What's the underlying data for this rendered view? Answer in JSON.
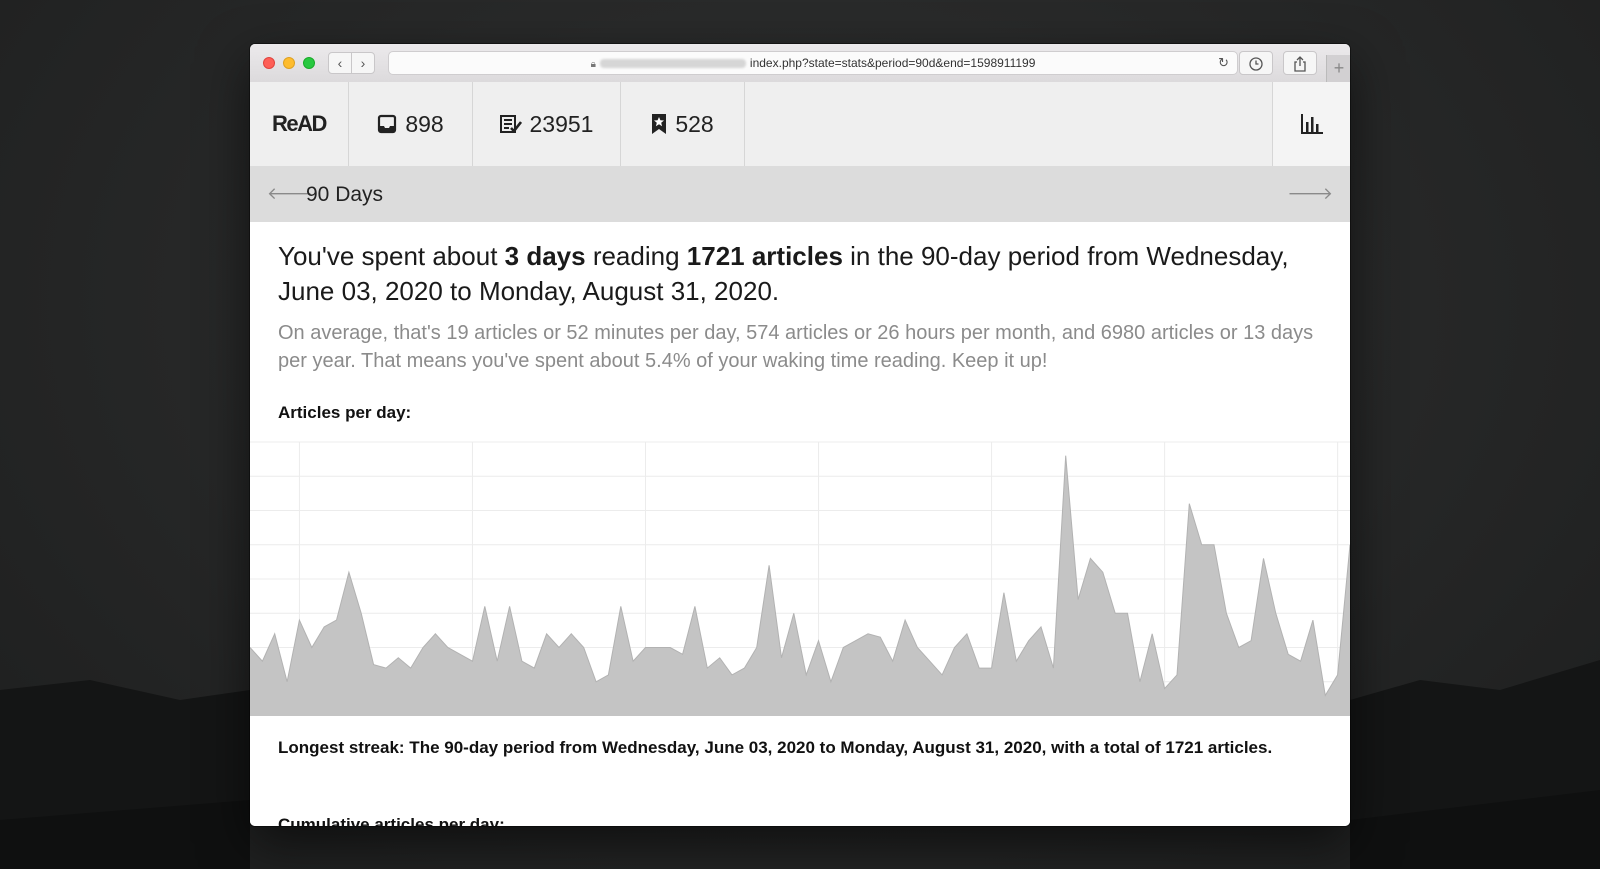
{
  "browser": {
    "url_visible": "index.php?state=stats&period=90d&end=1598911199",
    "icons": {
      "lock": "lock-icon",
      "reload": "reload-icon",
      "history": "clock-icon",
      "share": "share-icon",
      "new_tab": "plus-icon"
    }
  },
  "nav": {
    "logo": "ReAD",
    "unread_count": "898",
    "read_count": "23951",
    "bookmarked_count": "528",
    "icons": {
      "unread": "inbox-icon",
      "read": "checklist-icon",
      "bookmarked": "bookmark-star-icon",
      "stats": "bar-chart-icon"
    }
  },
  "period": {
    "label": "90 Days",
    "icons": {
      "prev": "arrow-left-icon",
      "next": "arrow-right-icon"
    }
  },
  "summary": {
    "part1": "You've spent about ",
    "time": "3 days",
    "part2": " reading ",
    "articles": "1721 articles",
    "part3": " in the 90-day period from Wednesday, June 03, 2020 to Monday, August 31, 2020."
  },
  "average_text": "On average, that's 19 articles or 52 minutes per day, 574 articles or 26 hours per month, and 6980 articles or 13 days per year. That means you've spent about 5.4% of your waking time reading. Keep it up!",
  "chart_title": "Articles per day:",
  "streak_text": "Longest streak: The 90-day period from Wednesday, June 03, 2020 to Monday, August 31, 2020, with a total of 1721 articles.",
  "cumulative_title": "Cumulative articles per day:",
  "chart_data": {
    "type": "area",
    "title": "Articles per day:",
    "xlabel": "",
    "ylabel": "",
    "grid": true,
    "ylim": [
      0,
      80
    ],
    "fill_color": "#c4c4c4",
    "values": [
      20,
      16,
      24,
      10,
      28,
      20,
      26,
      28,
      42,
      30,
      15,
      14,
      17,
      14,
      20,
      24,
      20,
      18,
      16,
      32,
      16,
      32,
      16,
      14,
      24,
      20,
      24,
      20,
      10,
      12,
      32,
      16,
      20,
      20,
      20,
      18,
      32,
      14,
      17,
      12,
      14,
      20,
      44,
      17,
      30,
      12,
      22,
      10,
      20,
      22,
      24,
      23,
      16,
      28,
      20,
      16,
      12,
      20,
      24,
      14,
      14,
      36,
      16,
      22,
      26,
      14,
      76,
      34,
      46,
      42,
      30,
      30,
      10,
      24,
      8,
      12,
      62,
      50,
      50,
      30,
      20,
      22,
      46,
      30,
      18,
      16,
      28,
      6,
      12,
      50
    ]
  }
}
